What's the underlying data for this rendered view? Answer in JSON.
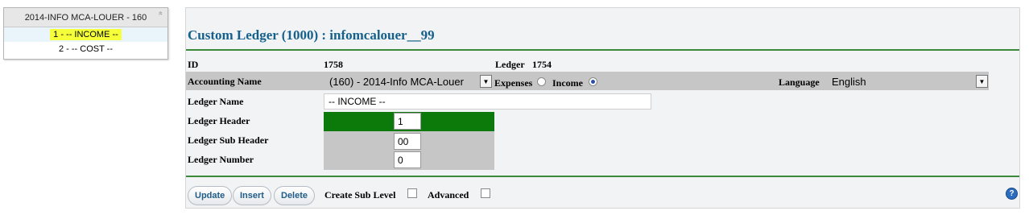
{
  "tree": {
    "title": "2014-INFO MCA-LOUER - 160",
    "collapse_icon": "«",
    "items": [
      {
        "label": "1 - -- INCOME --",
        "selected": true
      },
      {
        "label": "2 - -- COST --",
        "selected": false
      }
    ]
  },
  "form": {
    "title": "Custom Ledger (1000) : infomcalouer__99",
    "id_label": "ID",
    "id_value": "1758",
    "ledger_label": "Ledger",
    "ledger_value": "1754",
    "accounting_name_label": "Accounting Name",
    "accounting_name_value": "(160) - 2014-Info MCA-Louer",
    "expenses_label": "Expenses",
    "income_label": "Income",
    "type_selected": "Income",
    "language_label": "Language",
    "language_value": "English",
    "ledger_name_label": "Ledger Name",
    "ledger_name_value": "-- INCOME --",
    "ledger_header_label": "Ledger Header",
    "ledger_header_value": "1",
    "ledger_sub_header_label": "Ledger Sub Header",
    "ledger_sub_header_value": "00",
    "ledger_number_label": "Ledger Number",
    "ledger_number_value": "0"
  },
  "footer": {
    "update_label": "Update",
    "insert_label": "Insert",
    "delete_label": "Delete",
    "create_sub_level_label": "Create Sub Level",
    "advanced_label": "Advanced",
    "help_glyph": "?"
  },
  "colors": {
    "title": "#16608c",
    "rule": "#3a8a3a",
    "header_green": "#0b7a0b",
    "band_gray": "#c6c6c6",
    "highlight": "#f5ff3a"
  }
}
